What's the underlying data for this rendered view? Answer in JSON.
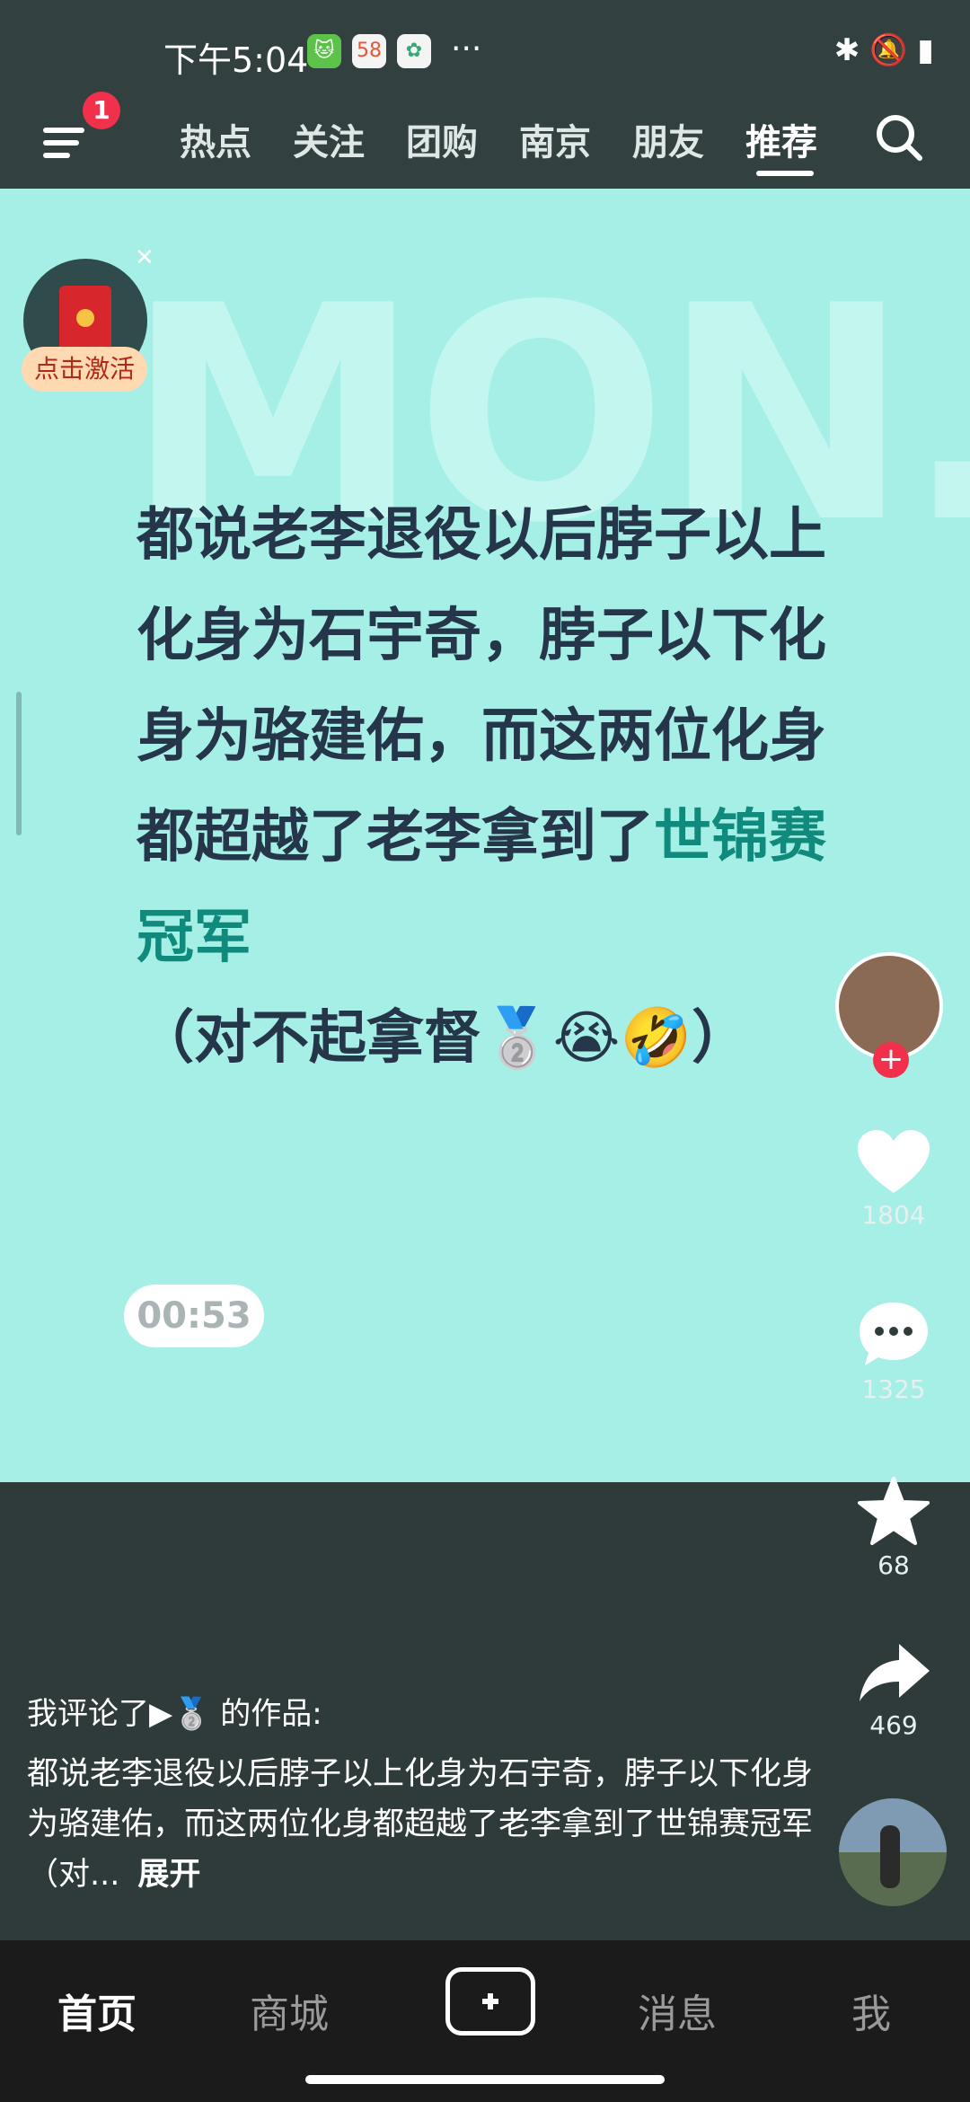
{
  "status_bar": {
    "time": "下午5:04",
    "more": "···"
  },
  "top_nav": {
    "badge": "1",
    "tabs": [
      "热点",
      "关注",
      "团购",
      "南京",
      "朋友",
      "推荐"
    ],
    "active_tab": "推荐"
  },
  "video": {
    "watermark": "MON.",
    "caption_parts": {
      "before": "都说老李退役以后脖子以上化身为石宇奇，脖子以下化身为骆建佑，而这两位化身都超越了老李拿到了",
      "highlight": "世锦赛冠军",
      "after": "（对不起拿督🥈😭🤣）"
    },
    "timer": "00:53",
    "activate_label": "点击激活"
  },
  "actions": {
    "follow": "+",
    "like_count": "1804",
    "comment_count": "1325",
    "favorite_count": "68",
    "share_count": "469"
  },
  "post": {
    "commented_line": "我评论了▶🥈 的作品:",
    "description": "都说老李退役以后脖子以上化身为石宇奇，脖子以下化身为骆建佑，而这两位化身都超越了老李拿到了世锦赛冠军（对...",
    "expand": "展开"
  },
  "bottom_nav": {
    "home": "首页",
    "mall": "商城",
    "messages": "消息",
    "me": "我"
  }
}
